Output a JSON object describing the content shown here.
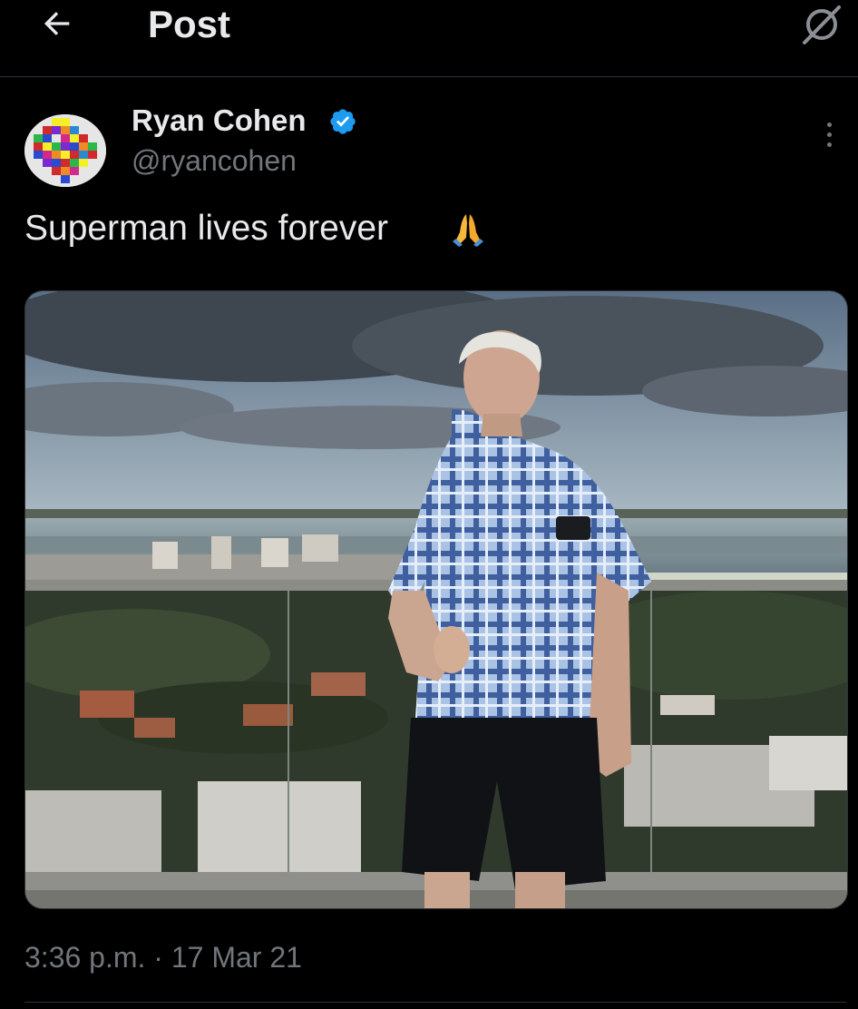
{
  "header": {
    "title": "Post",
    "back_icon": "arrow-left-icon",
    "grok_icon": "grok-icon"
  },
  "post": {
    "author": {
      "name": "Ryan Cohen",
      "handle": "@ryancohen",
      "verified": true,
      "verified_color": "#1d9bf0"
    },
    "text": "Superman lives forever",
    "emoji": "folded-hands-emoji",
    "media_icon": "photo-man-on-rooftop",
    "timestamp": "3:36 p.m. · 17 Mar 21"
  },
  "colors": {
    "background": "#000000",
    "text_primary": "#e7e9ea",
    "text_secondary": "#71767b",
    "divider": "#2f3336",
    "accent": "#1d9bf0"
  }
}
